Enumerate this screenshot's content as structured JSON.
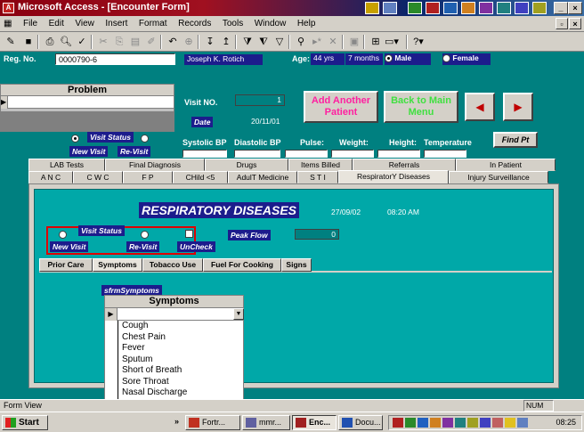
{
  "window": {
    "title": "Microsoft Access - [Encounter Form]",
    "app_icon": "access-icon"
  },
  "menu": [
    "File",
    "Edit",
    "View",
    "Insert",
    "Format",
    "Records",
    "Tools",
    "Window",
    "Help"
  ],
  "header": {
    "reg_label": "Reg. No.",
    "reg_value": "0000790-6",
    "patient_name": "Joseph K. Rotich",
    "age_label": "Age:",
    "age_years": "44",
    "age_years_unit": "yrs",
    "age_months": "7 months",
    "male": "Male",
    "female": "Female"
  },
  "problem": {
    "title": "Problem"
  },
  "visit": {
    "visit_no_label": "Visit NO.",
    "visit_no_value": "1",
    "date_label": "Date",
    "date_value": "20/11/01",
    "status_label": "Visit Status",
    "new_visit": "New Visit",
    "re_visit": "Re-Visit"
  },
  "buttons": {
    "add_patient": "Add Another Patient",
    "back_main": "Back to Main Menu",
    "find_pt": "Find Pt"
  },
  "vitals": [
    "Systolic BP",
    "Diastolic BP",
    "Pulse:",
    "Weight:",
    "Height:",
    "Temperature"
  ],
  "tabs_row1": [
    "LAB Tests",
    "Final Diagnosis",
    "Drugs",
    "Items Billed",
    "Referrals",
    "In Patient"
  ],
  "tabs_row2": [
    "A N C",
    "C W C",
    "F P",
    "CHild <5",
    "AdulT Medicine",
    "S T I",
    "RespiratorY Diseases",
    "Injury Surveillance"
  ],
  "resp": {
    "title": "RESPIRATORY DISEASES",
    "date": "27/09/02",
    "time": "08:20 AM",
    "visit_status": "Visit Status",
    "new_visit": "New Visit",
    "re_visit": "Re-Visit",
    "uncheck": "UnCheck",
    "peak_flow_label": "Peak Flow",
    "peak_flow_value": "0"
  },
  "subtabs": [
    "Prior Care",
    "Symptoms",
    "Tobacco Use",
    "Fuel For Cooking",
    "Signs"
  ],
  "symptoms": {
    "subform_label": "sfrmSymptoms",
    "header": "Symptoms",
    "items": [
      "Cough",
      "Chest Pain",
      "Fever",
      "Sputum",
      "Short of Breath",
      "Sore Throat",
      "Nasal Discharge"
    ]
  },
  "status": {
    "view": "Form View",
    "num": "NUM"
  },
  "taskbar": {
    "start": "Start",
    "tasks": [
      "Fortr...",
      "mmr...",
      "Enc...",
      "Docu..."
    ],
    "clock": "08:25"
  }
}
